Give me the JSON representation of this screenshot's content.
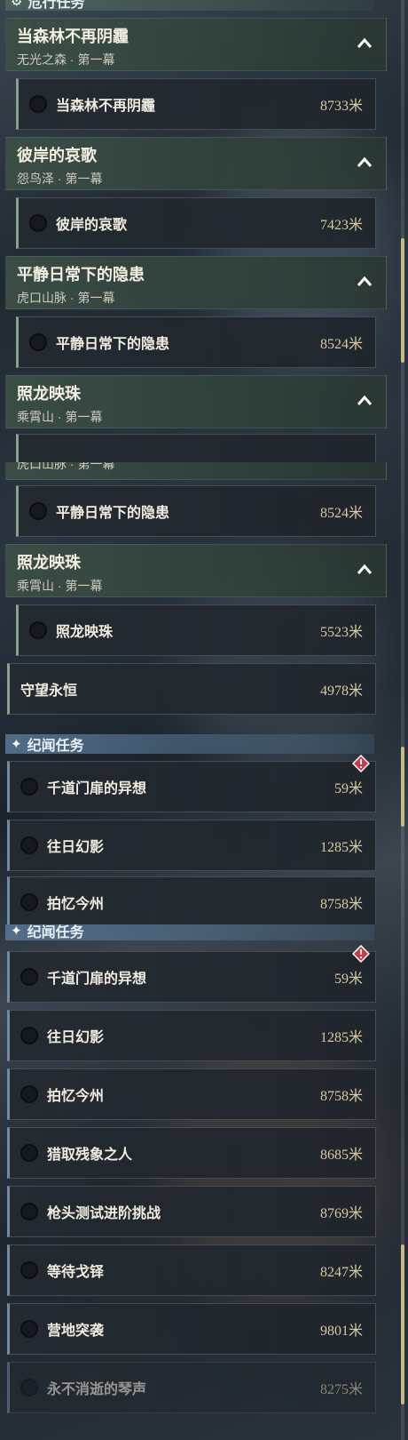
{
  "colors": {
    "accent_gold": "#d6c9a2",
    "danger_section": "#52695f",
    "story_section": "#5a7896",
    "warning": "#c83a4a"
  },
  "frame1": {
    "section_title": "危行任务",
    "groups": [
      {
        "title": "当森林不再阴霾",
        "subtitle": "无光之森 · 第一幕",
        "task": {
          "name": "当森林不再阴霾",
          "distance": "8733米"
        }
      },
      {
        "title": "彼岸的哀歌",
        "subtitle": "怨鸟泽 · 第一幕",
        "task": {
          "name": "彼岸的哀歌",
          "distance": "7423米"
        }
      },
      {
        "title": "平静日常下的隐患",
        "subtitle": "虎口山脉 · 第一幕",
        "task": {
          "name": "平静日常下的隐患",
          "distance": "8524米"
        }
      },
      {
        "title": "照龙映珠",
        "subtitle": "乘霄山 · 第一幕"
      }
    ]
  },
  "frame2": {
    "partial_subtitle": "虎口山脉 · 第一幕",
    "task_a": {
      "name": "平静日常下的隐患",
      "distance": "8524米"
    },
    "group": {
      "title": "照龙映珠",
      "subtitle": "乘霄山 · 第一幕"
    },
    "task_b": {
      "name": "照龙映珠",
      "distance": "5523米"
    },
    "task_c": {
      "name": "守望永恒",
      "distance": "4978米"
    },
    "section_title": "纪闻任务",
    "story_tasks": [
      {
        "name": "千道门扉的异想",
        "distance": "59米"
      },
      {
        "name": "往日幻影",
        "distance": "1285米"
      },
      {
        "name": "拍忆今州",
        "distance": "8758米"
      }
    ]
  },
  "frame3": {
    "section_title": "纪闻任务",
    "story_tasks": [
      {
        "name": "千道门扉的异想",
        "distance": "59米"
      },
      {
        "name": "往日幻影",
        "distance": "1285米"
      },
      {
        "name": "拍忆今州",
        "distance": "8758米"
      },
      {
        "name": "猎取残象之人",
        "distance": "8685米"
      },
      {
        "name": "枪头测试进阶挑战",
        "distance": "8769米"
      },
      {
        "name": "等待戈铎",
        "distance": "8247米"
      },
      {
        "name": "营地突袭",
        "distance": "9801米"
      },
      {
        "name": "永不消逝的琴声",
        "distance": "8275米"
      }
    ]
  },
  "icons": [
    "chevron-up-icon",
    "warning-diamond-icon",
    "sparkle-star-icon",
    "danger-section-icon",
    "task-status-circle-icon"
  ]
}
